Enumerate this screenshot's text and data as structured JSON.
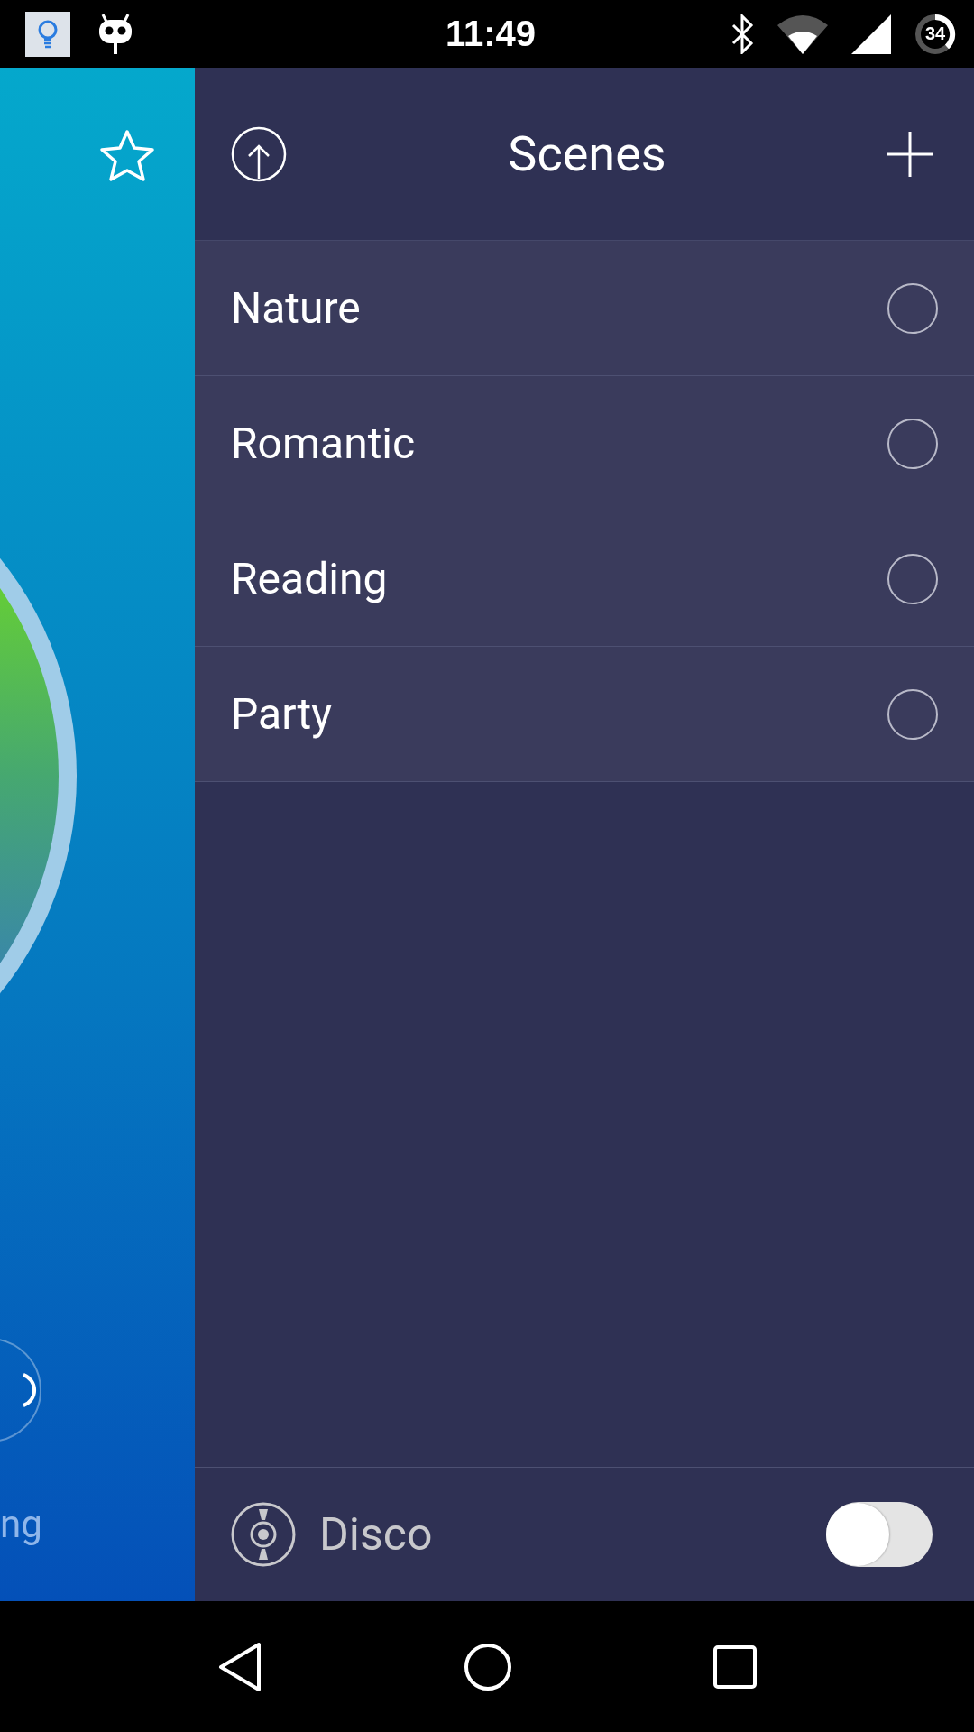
{
  "status_bar": {
    "time": "11:49",
    "battery": "34"
  },
  "side_panel": {
    "label": "ng"
  },
  "scenes": {
    "title": "Scenes",
    "items": [
      {
        "name": "Nature",
        "selected": false
      },
      {
        "name": "Romantic",
        "selected": false
      },
      {
        "name": "Reading",
        "selected": false
      },
      {
        "name": "Party",
        "selected": false
      }
    ]
  },
  "disco": {
    "label": "Disco",
    "on": false
  }
}
